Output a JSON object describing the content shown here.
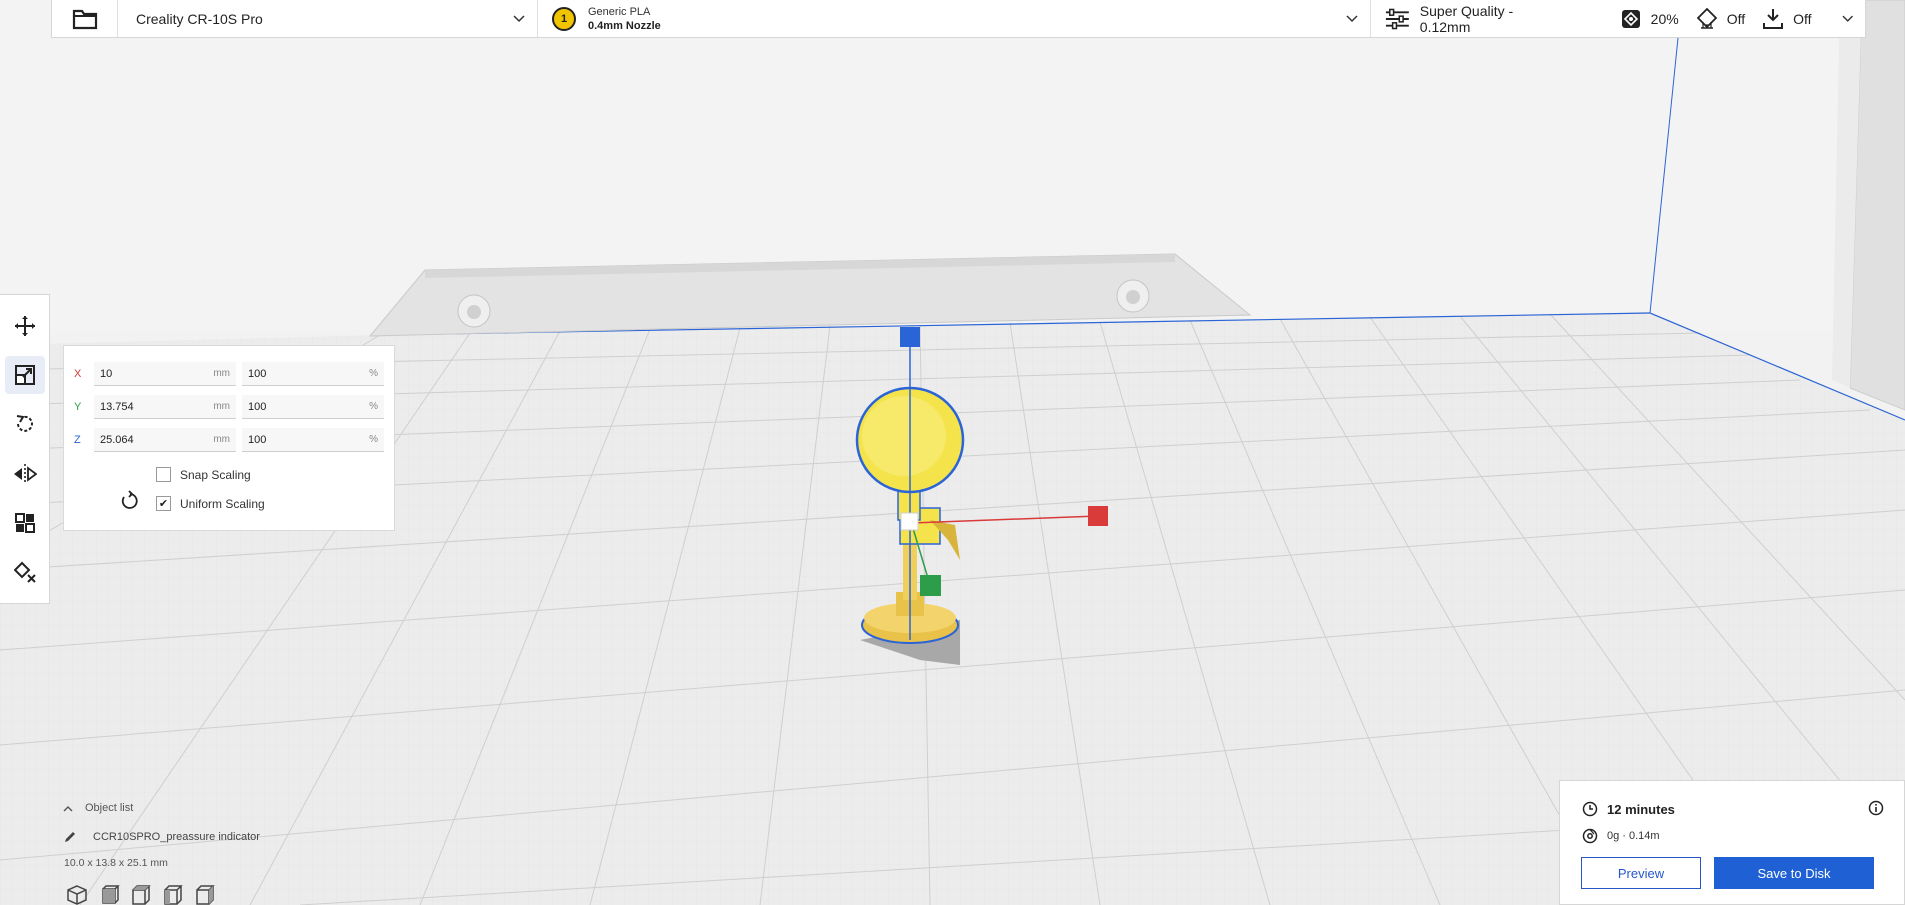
{
  "app": {
    "colors": {
      "accent": "#1f61d4",
      "x_axis": "#d93a3a",
      "y_axis": "#2e9d4a",
      "z_axis": "#2b64d6",
      "model": "#f4e34a"
    }
  },
  "topbar": {
    "open_icon": "folder-icon",
    "printer": {
      "name": "Creality CR-10S Pro"
    },
    "material": {
      "extruder_number": "1",
      "name": "Generic PLA",
      "nozzle": "0.4mm Nozzle"
    },
    "settings": {
      "profile": "Super Quality - 0.12mm",
      "infill": "20%",
      "support": "Off",
      "adhesion": "Off"
    }
  },
  "left_toolbar": {
    "tools": [
      "move-icon",
      "scale-icon",
      "rotate-icon",
      "mirror-icon",
      "per-model-settings-icon",
      "support-blocker-icon"
    ],
    "active": "scale-icon"
  },
  "scale_panel": {
    "rows": [
      {
        "axis": "X",
        "mm": "10",
        "percent": "100"
      },
      {
        "axis": "Y",
        "mm": "13.754",
        "percent": "100"
      },
      {
        "axis": "Z",
        "mm": "25.064",
        "percent": "100"
      }
    ],
    "unit_mm": "mm",
    "unit_percent": "%",
    "snap_scaling": {
      "label": "Snap Scaling",
      "checked": false
    },
    "uniform_scaling": {
      "label": "Uniform Scaling",
      "checked": true,
      "mark": "✔"
    }
  },
  "object_list": {
    "toggle_label": "Object list",
    "object_name": "CCR10SPRO_preassure indicator",
    "dimensions": "10.0 x 13.8 x 25.1 mm"
  },
  "print_panel": {
    "time": "12 minutes",
    "material": "0g · 0.14m",
    "preview_label": "Preview",
    "save_label": "Save to Disk"
  }
}
